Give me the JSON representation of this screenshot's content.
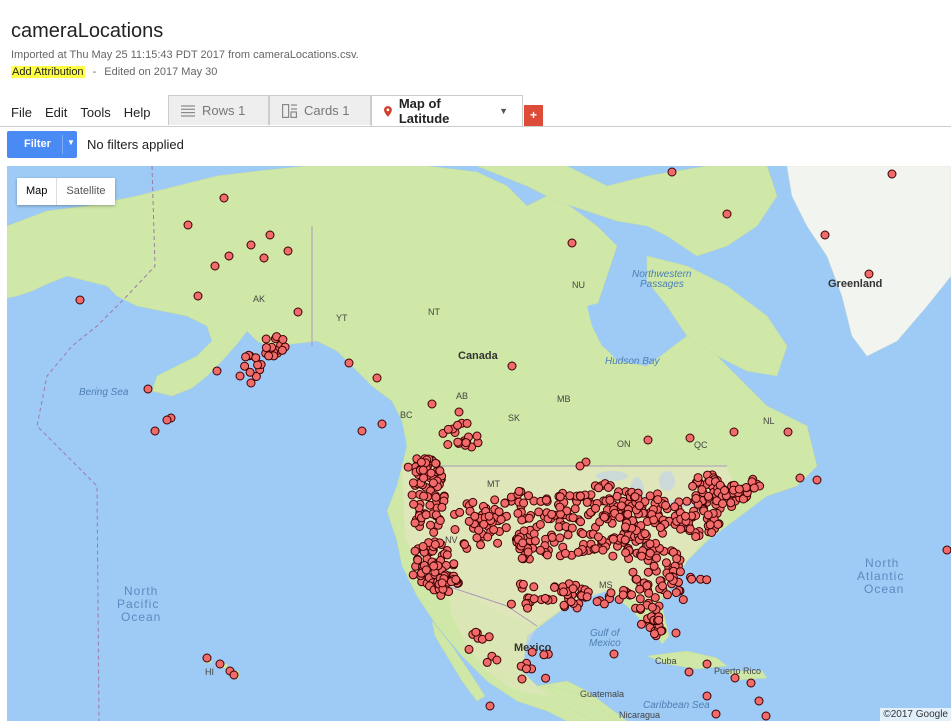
{
  "header": {
    "title": "cameraLocations",
    "imported": "Imported at Thu May 25 11:15:43 PDT 2017 from cameraLocations.csv.",
    "add_attribution": "Add Attribution",
    "separator": "-",
    "edited": "Edited on 2017 May 30"
  },
  "menu": {
    "file": "File",
    "edit": "Edit",
    "tools": "Tools",
    "help": "Help"
  },
  "tabs": [
    {
      "label": "Rows 1",
      "icon": "rows-icon"
    },
    {
      "label": "Cards 1",
      "icon": "cards-icon"
    },
    {
      "label": "Map of Latitude",
      "icon": "map-pin-icon",
      "active": true
    }
  ],
  "add_tab": "+",
  "filter": {
    "button": "Filter",
    "status": "No filters applied"
  },
  "map": {
    "type_buttons": [
      "Map",
      "Satellite"
    ],
    "selected_type": "Map",
    "copyright": "©2017 Google",
    "labels": {
      "greenland": "Greenland",
      "nu": "NU",
      "nw_passages": [
        "Northwestern",
        "Passages"
      ],
      "nt": "NT",
      "yt": "YT",
      "ak": "AK",
      "canada": "Canada",
      "hudson_bay": "Hudson Bay",
      "bering_sea": "Bering Sea",
      "bc": "BC",
      "ab": "AB",
      "sk": "SK",
      "mb": "MB",
      "on": "ON",
      "qc": "QC",
      "nl": "NL",
      "mt": "MT",
      "nv": "NV",
      "ms": "MS",
      "mexico": "Mexico",
      "gulf": [
        "Gulf of",
        "Mexico"
      ],
      "cuba": "Cuba",
      "puerto_rico": "Puerto Rico",
      "guatemala": "Guatemala",
      "caribbean": "Caribbean Sea",
      "nicaragua": "Nicaragua",
      "hi": "HI",
      "north_atlantic": [
        "North",
        "Atlantic",
        "Ocean"
      ],
      "north_pacific": [
        "North",
        "Pacific",
        "Ocean"
      ]
    },
    "marker_color": "#f26b6b",
    "marker_stroke": "#3a0000",
    "land_color": "#cfe8a8",
    "water_color": "#9ecbf5"
  }
}
